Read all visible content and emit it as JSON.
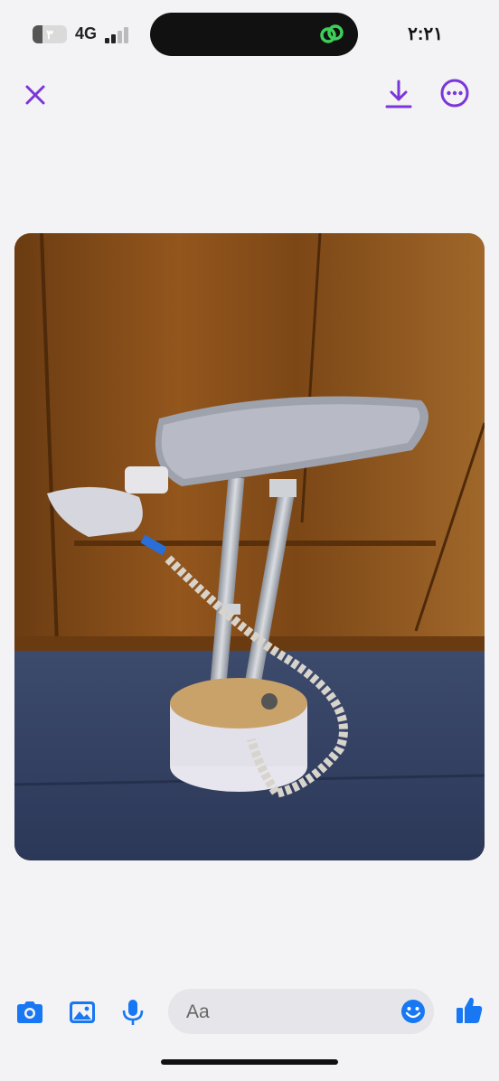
{
  "status_bar": {
    "battery_level": "٣",
    "battery_fraction": 0.3,
    "network": "4G",
    "signal_bars_active": 2,
    "signal_bars_total": 4,
    "time": "٢:٢١",
    "island_icon": "link-rings-icon"
  },
  "toolbar": {
    "close_icon": "close-icon",
    "download_icon": "download-icon",
    "more_icon": "more-options-icon"
  },
  "photo": {
    "subject": "garment-steamer-photo"
  },
  "composer": {
    "placeholder": "Aa",
    "camera_icon": "camera-icon",
    "gallery_icon": "image-gallery-icon",
    "mic_icon": "microphone-icon",
    "emoji_icon": "emoji-icon",
    "like_icon": "thumbs-up-icon"
  },
  "colors": {
    "accent": "#7b36d9",
    "messenger_blue": "#1877f2",
    "background": "#f3f3f5"
  }
}
